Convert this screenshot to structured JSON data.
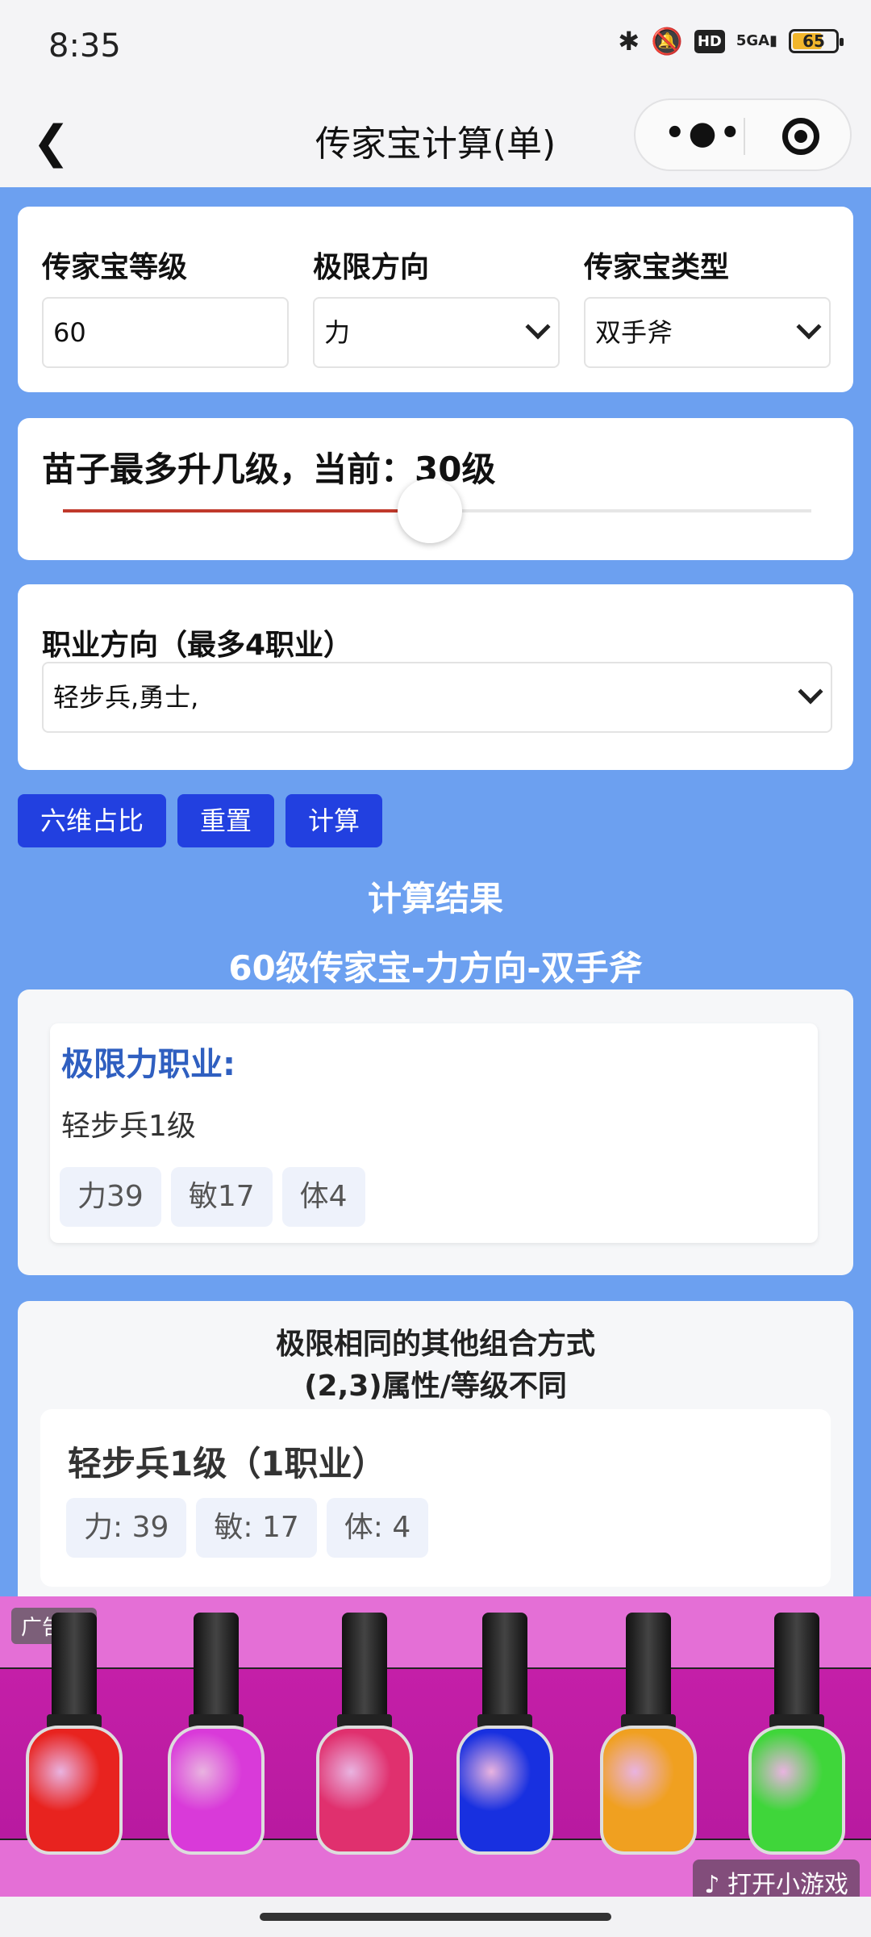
{
  "status_bar": {
    "time": "8:35",
    "network": "5GA",
    "hd": "HD",
    "battery": "65"
  },
  "nav": {
    "title": "传家宝计算(单)"
  },
  "form": {
    "level_label": "传家宝等级",
    "level_value": "60",
    "direction_label": "极限方向",
    "direction_value": "力",
    "type_label": "传家宝类型",
    "type_value": "双手斧"
  },
  "slider": {
    "label": "苗子最多升几级，当前：30级",
    "value_fraction": 0.49
  },
  "job": {
    "label": "职业方向（最多4职业）",
    "value": "轻步兵,勇士,"
  },
  "buttons": {
    "ratio": "六维占比",
    "reset": "重置",
    "calc": "计算"
  },
  "result": {
    "title": "计算结果",
    "subtitle": "60级传家宝-力方向-双手斧",
    "card_title": "极限力职业:",
    "card_text": "轻步兵1级",
    "tags": [
      "力39",
      "敏17",
      "体4"
    ]
  },
  "combos": {
    "title_line1": "极限相同的其他组合方式",
    "title_line2": "(2,3)属性/等级不同",
    "item_title": "轻步兵1级（1职业）",
    "tags": [
      "力: 39",
      "敏: 17",
      "体: 4"
    ]
  },
  "ad": {
    "label": "广告",
    "cta": "打开小游戏",
    "colors": [
      "#e8231f",
      "#d93ad9",
      "#e0306e",
      "#1830e0",
      "#f0a020",
      "#3fd63a"
    ]
  }
}
